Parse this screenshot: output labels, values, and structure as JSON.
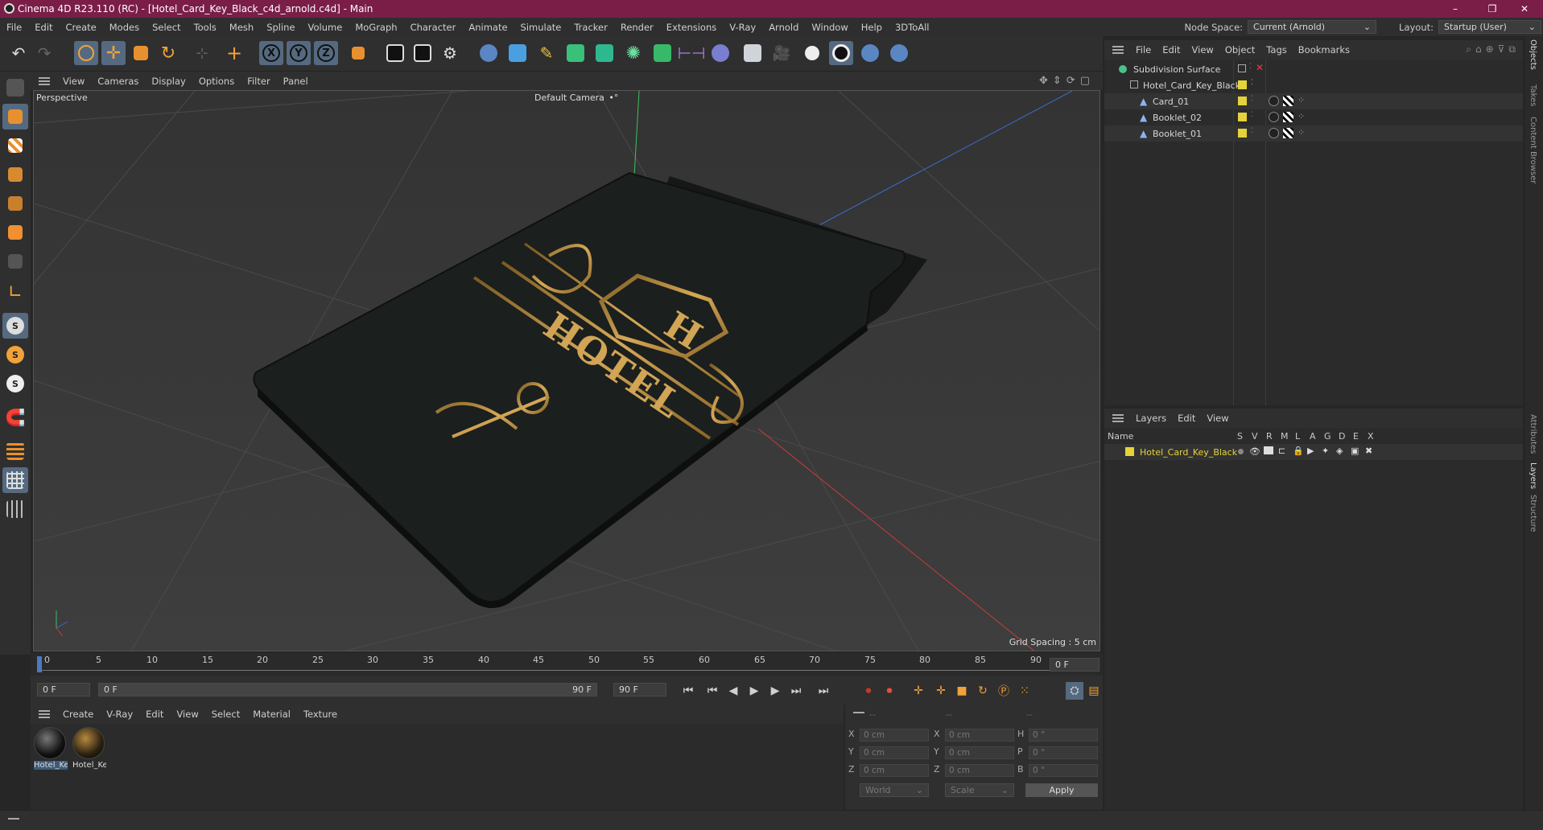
{
  "window": {
    "title": "Cinema 4D R23.110 (RC) - [Hotel_Card_Key_Black_c4d_arnold.c4d] - Main",
    "controls": [
      "–",
      "❐",
      "✕"
    ]
  },
  "menubar": {
    "items": [
      "File",
      "Edit",
      "Create",
      "Modes",
      "Select",
      "Tools",
      "Mesh",
      "Spline",
      "Volume",
      "MoGraph",
      "Character",
      "Animate",
      "Simulate",
      "Tracker",
      "Render",
      "Extensions",
      "V-Ray",
      "Arnold",
      "Window",
      "Help",
      "3DToAll"
    ],
    "node_space_label": "Node Space:",
    "node_space_value": "Current (Arnold)",
    "layout_label": "Layout:",
    "layout_value": "Startup (User)"
  },
  "toolbar": {
    "axis_labels": [
      "X",
      "Y",
      "Z"
    ]
  },
  "viewport": {
    "menu": [
      "View",
      "Cameras",
      "Display",
      "Options",
      "Filter",
      "Panel"
    ],
    "label": "Perspective",
    "camera": "Default Camera",
    "camera_icon": "•°",
    "grid_spacing": "Grid Spacing : 5 cm",
    "card_text": "HOTEL",
    "card_letter": "H"
  },
  "timeline": {
    "ticks": [
      "0",
      "5",
      "10",
      "15",
      "20",
      "25",
      "30",
      "35",
      "40",
      "45",
      "50",
      "55",
      "60",
      "65",
      "70",
      "75",
      "80",
      "85",
      "90"
    ],
    "current_frame": "0 F"
  },
  "transport": {
    "start_field": "0 F",
    "range_start": "0 F",
    "range_end": "90 F",
    "end_field": "90 F"
  },
  "material_manager": {
    "menu": [
      "Create",
      "V-Ray",
      "Edit",
      "View",
      "Select",
      "Material",
      "Texture"
    ],
    "materials": [
      "Hotel_Ke",
      "Hotel_Ke"
    ]
  },
  "coordinates": {
    "header": [
      "--",
      "--",
      "--"
    ],
    "rows": [
      {
        "a": "X",
        "av": "0 cm",
        "b": "X",
        "bv": "0 cm",
        "c": "H",
        "cv": "0 °"
      },
      {
        "a": "Y",
        "av": "0 cm",
        "b": "Y",
        "bv": "0 cm",
        "c": "P",
        "cv": "0 °"
      },
      {
        "a": "Z",
        "av": "0 cm",
        "b": "Z",
        "bv": "0 cm",
        "c": "B",
        "cv": "0 °"
      }
    ],
    "mode1": "World",
    "mode2": "Scale",
    "apply": "Apply"
  },
  "object_manager": {
    "menu": [
      "File",
      "Edit",
      "View",
      "Object",
      "Tags",
      "Bookmarks"
    ],
    "objects": [
      {
        "name": "Subdivision Surface",
        "indent": 0
      },
      {
        "name": "Hotel_Card_Key_Black",
        "indent": 1
      },
      {
        "name": "Card_01",
        "indent": 2
      },
      {
        "name": "Booklet_02",
        "indent": 2
      },
      {
        "name": "Booklet_01",
        "indent": 2
      }
    ]
  },
  "layers_manager": {
    "menu": [
      "Layers",
      "Edit",
      "View"
    ],
    "col_name": "Name",
    "cols": [
      "S",
      "V",
      "R",
      "M",
      "L",
      "A",
      "G",
      "D",
      "E",
      "X"
    ],
    "layers": [
      {
        "name": "Hotel_Card_Key_Black",
        "color": "#e5d33a"
      }
    ]
  },
  "right_tabs": [
    "Objects",
    "Takes",
    "Content Browser",
    "Attributes",
    "Layers",
    "Structure"
  ],
  "colors": {
    "title_bar": "#7a1e48",
    "accent_blue": "#556a80",
    "layer_yellow": "#e5d33a",
    "gold": "#b48a3a",
    "card": "#1b1f1e"
  }
}
